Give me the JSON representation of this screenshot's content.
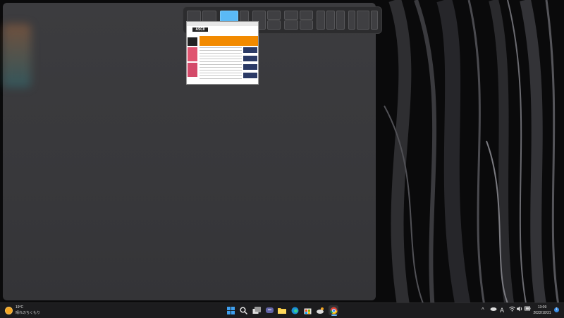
{
  "desktop": {
    "wallpaper": "dark-abstract-streaks",
    "accent_color": "#5ab9f5"
  },
  "snap_layouts": {
    "active_zone": "layout2-zone2"
  },
  "thumbnail": {
    "logo_text": "ASCII"
  },
  "taskbar": {
    "weather": {
      "temperature": "19°C",
      "condition": "晴れのちくもり",
      "icon": "sun-cloud-icon"
    },
    "apps": [
      {
        "name": "start",
        "icon": "windows-start-icon"
      },
      {
        "name": "search",
        "icon": "search-icon"
      },
      {
        "name": "task-view",
        "icon": "task-view-icon"
      },
      {
        "name": "chat",
        "icon": "teams-chat-icon"
      },
      {
        "name": "file-explorer",
        "icon": "folder-icon"
      },
      {
        "name": "edge",
        "icon": "edge-icon"
      },
      {
        "name": "store",
        "icon": "store-icon"
      },
      {
        "name": "weather-app",
        "icon": "weather-app-icon"
      },
      {
        "name": "chrome",
        "icon": "chrome-icon",
        "running": true
      }
    ],
    "tray": {
      "chevron": "^",
      "onedrive": "onedrive-icon",
      "ime": "A",
      "wifi": "wifi-icon",
      "volume": "volume-icon",
      "battery": "battery-icon"
    },
    "clock": {
      "time": "13:09",
      "date": "2022/10/31"
    },
    "notifications_count": "1"
  }
}
